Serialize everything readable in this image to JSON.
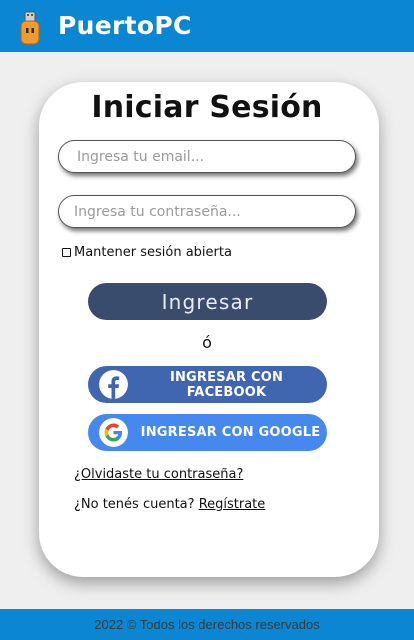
{
  "header": {
    "brand": "PuertoPC",
    "logo_icon": "usb-drive-icon"
  },
  "login": {
    "title": "Iniciar Sesión",
    "email_placeholder": "Ingresa tu email...",
    "password_placeholder": "Ingresa tu contraseña...",
    "remember_label": "Mantener sesión abierta",
    "remember_checked": false,
    "submit_label": "Ingresar",
    "or_text": "ó",
    "facebook_label": "INGRESAR CON FACEBOOK",
    "google_label": "INGRESAR CON GOOGLE",
    "forgot_label": "¿Olvidaste tu contraseña?",
    "no_account_text": "¿No tenés cuenta?",
    "signup_label": "Regístrate"
  },
  "footer": {
    "text": "2022 © Todos los derechos reservados"
  },
  "colors": {
    "header_bg": "#0b86d3",
    "submit_bg": "#3a4c6e",
    "facebook_bg": "#4066b0",
    "google_bg": "#4589ee",
    "page_bg": "#efefef"
  }
}
